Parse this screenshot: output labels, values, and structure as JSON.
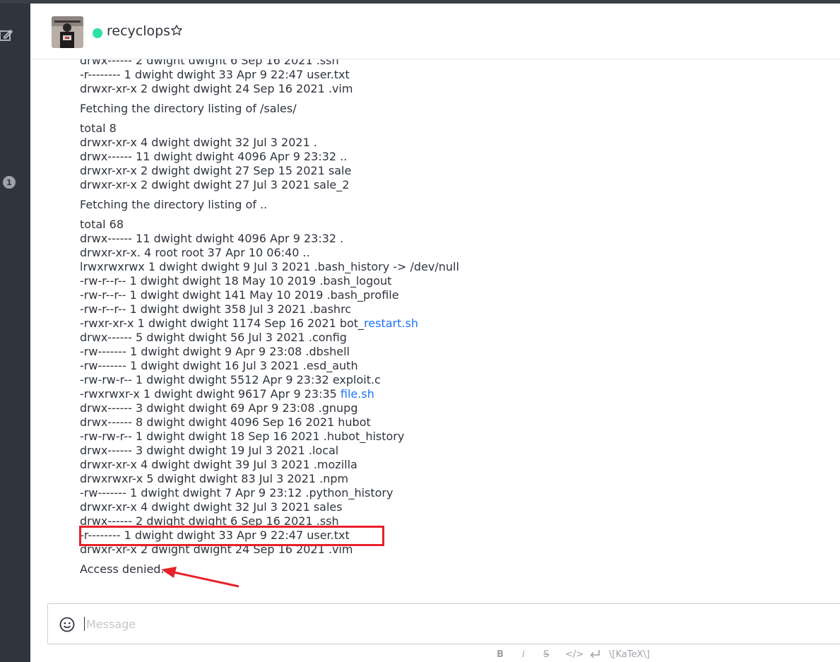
{
  "header": {
    "room_name": "recyclops"
  },
  "sidebar": {
    "unread_badge": "1"
  },
  "messages": [
    {
      "type": "line",
      "text": "drwx------ 2 dwight dwight 6 Sep 16 2021 .ssh"
    },
    {
      "type": "line",
      "text": "-r-------- 1 dwight dwight 33 Apr 9 22:47 user.txt"
    },
    {
      "type": "line",
      "text": "drwxr-xr-x 2 dwight dwight 24 Sep 16 2021 .vim"
    },
    {
      "type": "gap"
    },
    {
      "type": "line",
      "text": "Fetching the directory listing of /sales/"
    },
    {
      "type": "gap"
    },
    {
      "type": "line",
      "text": "total 8"
    },
    {
      "type": "line",
      "text": "drwxr-xr-x 4 dwight dwight 32 Jul 3 2021 ."
    },
    {
      "type": "line",
      "text": "drwx------ 11 dwight dwight 4096 Apr 9 23:32 .."
    },
    {
      "type": "line",
      "text": "drwxr-xr-x 2 dwight dwight 27 Sep 15 2021 sale"
    },
    {
      "type": "line",
      "text": "drwxr-xr-x 2 dwight dwight 27 Jul 3 2021 sale_2"
    },
    {
      "type": "gap"
    },
    {
      "type": "line",
      "text": "Fetching the directory listing of .."
    },
    {
      "type": "gap"
    },
    {
      "type": "line",
      "text": "total 68"
    },
    {
      "type": "line",
      "text": "drwx------ 11 dwight dwight 4096 Apr 9 23:32 ."
    },
    {
      "type": "line",
      "text": "drwxr-xr-x. 4 root root 37 Apr 10 06:40 .."
    },
    {
      "type": "line",
      "text": "lrwxrwxrwx 1 dwight dwight 9 Jul 3 2021 .bash_history -> /dev/null"
    },
    {
      "type": "line",
      "text": "-rw-r--r-- 1 dwight dwight 18 May 10 2019 .bash_logout"
    },
    {
      "type": "line",
      "text": "-rw-r--r-- 1 dwight dwight 141 May 10 2019 .bash_profile"
    },
    {
      "type": "line",
      "text": "-rw-r--r-- 1 dwight dwight 358 Jul 3 2021 .bashrc"
    },
    {
      "type": "line",
      "text": "-rwxr-xr-x 1 dwight dwight 1174 Sep 16 2021 bot_",
      "link": "restart.sh"
    },
    {
      "type": "line",
      "text": "drwx------ 5 dwight dwight 56 Jul 3 2021 .config"
    },
    {
      "type": "line",
      "text": "-rw------- 1 dwight dwight 9 Apr 9 23:08 .dbshell"
    },
    {
      "type": "line",
      "text": "-rw------- 1 dwight dwight 16 Jul 3 2021 .esd_auth"
    },
    {
      "type": "line",
      "text": "-rw-rw-r-- 1 dwight dwight 5512 Apr 9 23:32 exploit.c"
    },
    {
      "type": "line",
      "text": "-rwxrwxr-x 1 dwight dwight 9617 Apr 9 23:35 ",
      "link": "file.sh"
    },
    {
      "type": "line",
      "text": "drwx------ 3 dwight dwight 69 Apr 9 23:08 .gnupg"
    },
    {
      "type": "line",
      "text": "drwx------ 8 dwight dwight 4096 Sep 16 2021 hubot"
    },
    {
      "type": "line",
      "text": "-rw-rw-r-- 1 dwight dwight 18 Sep 16 2021 .hubot_history"
    },
    {
      "type": "line",
      "text": "drwx------ 3 dwight dwight 19 Jul 3 2021 .local"
    },
    {
      "type": "line",
      "text": "drwxr-xr-x 4 dwight dwight 39 Jul 3 2021 .mozilla"
    },
    {
      "type": "line",
      "text": "drwxrwxr-x 5 dwight dwight 83 Jul 3 2021 .npm"
    },
    {
      "type": "line",
      "text": "-rw------- 1 dwight dwight 7 Apr 9 23:12 .python_history"
    },
    {
      "type": "line",
      "text": "drwxr-xr-x 4 dwight dwight 32 Jul 3 2021 sales"
    },
    {
      "type": "line",
      "text": "drwx------ 2 dwight dwight 6 Sep 16 2021 .ssh"
    },
    {
      "type": "line",
      "text": "-r-------- 1 dwight dwight 33 Apr 9 22:47 user.txt"
    },
    {
      "type": "line",
      "text": "drwxr-xr-x 2 dwight dwight 24 Sep 16 2021 .vim"
    },
    {
      "type": "gap"
    },
    {
      "type": "line",
      "text": "Access denied."
    }
  ],
  "composer": {
    "placeholder": "Message"
  },
  "formatting": {
    "bold": "B",
    "italic": "i",
    "strike": "S",
    "code": "</>",
    "katex": "\\[KaTeX\\]"
  },
  "colors": {
    "sidebar": "#2f343d",
    "status_online": "#2de0a5",
    "link": "#1d74f5",
    "annotation": "#e8202a"
  }
}
